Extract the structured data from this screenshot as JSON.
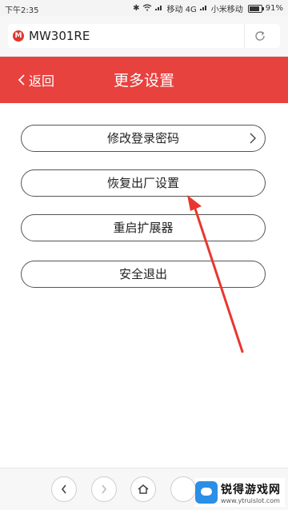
{
  "status_bar": {
    "time": "下午2:35",
    "carrier1": "移动 4G",
    "carrier2": "小米移动",
    "battery": "91%"
  },
  "address_bar": {
    "site_logo_letter": "M",
    "url": "MW301RE"
  },
  "header": {
    "back_label": "返回",
    "title": "更多设置",
    "bg_color": "#e8423f"
  },
  "menu": {
    "items": [
      {
        "label": "修改登录密码"
      },
      {
        "label": "恢复出厂设置"
      },
      {
        "label": "重启扩展器"
      },
      {
        "label": "安全退出"
      }
    ]
  },
  "watermark": {
    "title": "锐得游戏网",
    "url": "www.ytruislot.com"
  },
  "icons": [
    "signal-icon",
    "wifi-icon",
    "battery-icon",
    "refresh-icon",
    "chevron-left-icon",
    "chevron-right-icon",
    "home-icon",
    "annotation-arrow"
  ]
}
